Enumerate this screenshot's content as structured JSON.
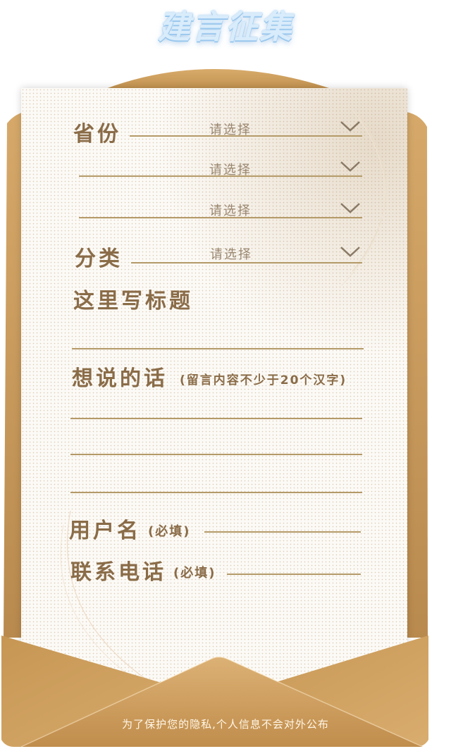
{
  "header": {
    "title": "建言征集"
  },
  "form": {
    "province_label": "省份",
    "province_placeholder": "请选择",
    "city_placeholder": "请选择",
    "district_placeholder": "请选择",
    "category_label": "分类",
    "category_placeholder": "请选择",
    "title_label": "这里写标题",
    "message_label": "想说的话",
    "message_hint": "(留言内容不少于20个汉字)",
    "username_label": "用户名",
    "username_hint": "(必填)",
    "phone_label": "联系电话",
    "phone_hint": "(必填)"
  },
  "footer": {
    "note": "为了保护您的隐私,个人信息不会对外公布"
  },
  "colors": {
    "envelope": "#c99c5c",
    "ink": "#8a6c48",
    "line": "#b49a68",
    "paper": "#fcfaf6"
  },
  "icons": {
    "dropdown": "chevron-down-icon"
  }
}
